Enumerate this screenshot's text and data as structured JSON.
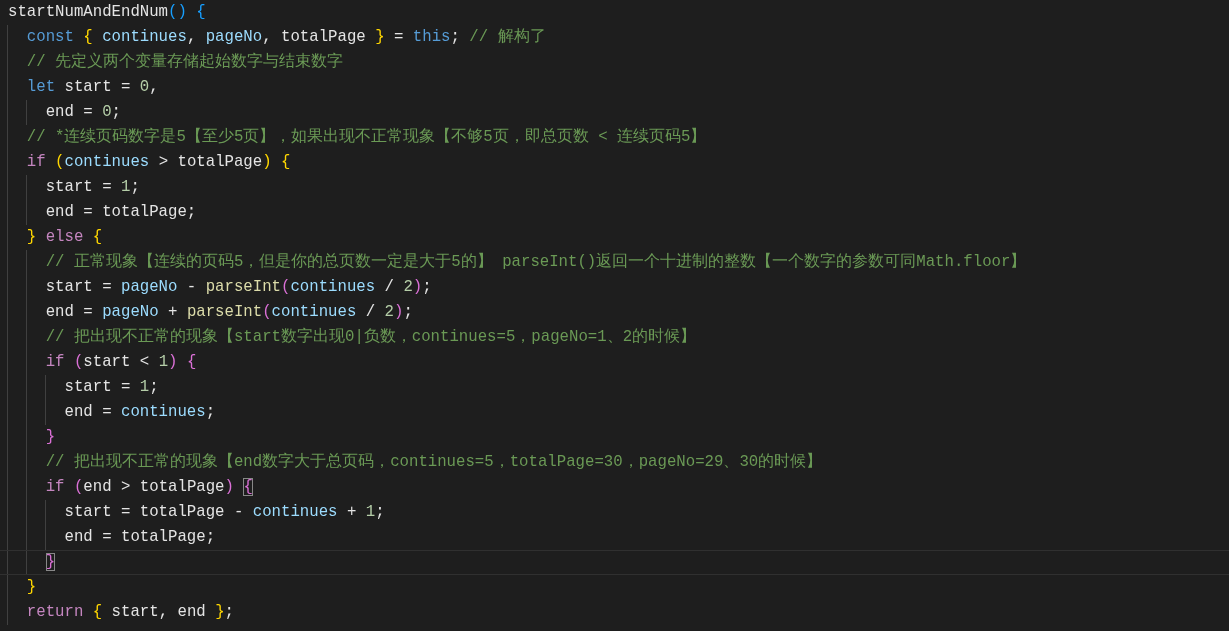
{
  "editor": {
    "lines": [
      {
        "cursor": false,
        "tokens": [
          {
            "kind": "id",
            "text": "startNumAndEndNum"
          },
          {
            "kind": "b3",
            "text": "() "
          },
          {
            "kind": "b3",
            "text": "{"
          }
        ]
      },
      {
        "cursor": false,
        "tokens": [
          {
            "kind": "kw",
            "text": "  const "
          },
          {
            "kind": "b1",
            "text": "{ "
          },
          {
            "kind": "var",
            "text": "continues"
          },
          {
            "kind": "op",
            "text": ", "
          },
          {
            "kind": "var",
            "text": "pageNo"
          },
          {
            "kind": "op",
            "text": ", totalPage "
          },
          {
            "kind": "b1",
            "text": "}"
          },
          {
            "kind": "op",
            "text": " = "
          },
          {
            "kind": "kw",
            "text": "this"
          },
          {
            "kind": "op",
            "text": "; "
          },
          {
            "kind": "cm",
            "text": "// 解构了"
          }
        ]
      },
      {
        "cursor": false,
        "tokens": [
          {
            "kind": "cm",
            "text": "  // 先定义两个变量存储起始数字与结束数字"
          }
        ]
      },
      {
        "cursor": false,
        "tokens": [
          {
            "kind": "kw",
            "text": "  let"
          },
          {
            "kind": "op",
            "text": " start = "
          },
          {
            "kind": "num",
            "text": "0"
          },
          {
            "kind": "op",
            "text": ","
          }
        ]
      },
      {
        "cursor": false,
        "tokens": [
          {
            "kind": "op",
            "text": "    end = "
          },
          {
            "kind": "num",
            "text": "0"
          },
          {
            "kind": "op",
            "text": ";"
          }
        ]
      },
      {
        "cursor": false,
        "tokens": [
          {
            "kind": "cm",
            "text": "  // *连续页码数字是5【至少5页】，如果出现不正常现象【不够5页，即总页数 < 连续页码5】"
          }
        ]
      },
      {
        "cursor": false,
        "tokens": [
          {
            "kind": "ctl",
            "text": "  if "
          },
          {
            "kind": "b1",
            "text": "("
          },
          {
            "kind": "var",
            "text": "continues"
          },
          {
            "kind": "op",
            "text": " > totalPage"
          },
          {
            "kind": "b1",
            "text": ") "
          },
          {
            "kind": "b1",
            "text": "{"
          }
        ]
      },
      {
        "cursor": false,
        "tokens": [
          {
            "kind": "op",
            "text": "    start = "
          },
          {
            "kind": "num",
            "text": "1"
          },
          {
            "kind": "op",
            "text": ";"
          }
        ]
      },
      {
        "cursor": false,
        "tokens": [
          {
            "kind": "op",
            "text": "    end = totalPage;"
          }
        ]
      },
      {
        "cursor": false,
        "tokens": [
          {
            "kind": "b1",
            "text": "  } "
          },
          {
            "kind": "ctl",
            "text": "else "
          },
          {
            "kind": "b1",
            "text": "{"
          }
        ]
      },
      {
        "cursor": false,
        "tokens": [
          {
            "kind": "cm",
            "text": "    // 正常现象【连续的页码5，但是你的总页数一定是大于5的】 parseInt()返回一个十进制的整数【一个数字的参数可同Math.floor】"
          }
        ]
      },
      {
        "cursor": false,
        "tokens": [
          {
            "kind": "op",
            "text": "    start = "
          },
          {
            "kind": "var",
            "text": "pageNo"
          },
          {
            "kind": "op",
            "text": " - "
          },
          {
            "kind": "fn",
            "text": "parseInt"
          },
          {
            "kind": "b2",
            "text": "("
          },
          {
            "kind": "var",
            "text": "continues"
          },
          {
            "kind": "op",
            "text": " / "
          },
          {
            "kind": "num",
            "text": "2"
          },
          {
            "kind": "b2",
            "text": ")"
          },
          {
            "kind": "op",
            "text": ";"
          }
        ]
      },
      {
        "cursor": false,
        "tokens": [
          {
            "kind": "op",
            "text": "    end = "
          },
          {
            "kind": "var",
            "text": "pageNo"
          },
          {
            "kind": "op",
            "text": " + "
          },
          {
            "kind": "fn",
            "text": "parseInt"
          },
          {
            "kind": "b2",
            "text": "("
          },
          {
            "kind": "var",
            "text": "continues"
          },
          {
            "kind": "op",
            "text": " / "
          },
          {
            "kind": "num",
            "text": "2"
          },
          {
            "kind": "b2",
            "text": ")"
          },
          {
            "kind": "op",
            "text": ";"
          }
        ]
      },
      {
        "cursor": false,
        "tokens": [
          {
            "kind": "cm",
            "text": "    // 把出现不正常的现象【start数字出现0|负数，continues=5，pageNo=1、2的时候】"
          }
        ]
      },
      {
        "cursor": false,
        "tokens": [
          {
            "kind": "ctl",
            "text": "    if "
          },
          {
            "kind": "b2",
            "text": "("
          },
          {
            "kind": "op",
            "text": "start < "
          },
          {
            "kind": "num",
            "text": "1"
          },
          {
            "kind": "b2",
            "text": ") "
          },
          {
            "kind": "b2",
            "text": "{"
          }
        ]
      },
      {
        "cursor": false,
        "tokens": [
          {
            "kind": "op",
            "text": "      start = "
          },
          {
            "kind": "num",
            "text": "1"
          },
          {
            "kind": "op",
            "text": ";"
          }
        ]
      },
      {
        "cursor": false,
        "tokens": [
          {
            "kind": "op",
            "text": "      end = "
          },
          {
            "kind": "var",
            "text": "continues"
          },
          {
            "kind": "op",
            "text": ";"
          }
        ]
      },
      {
        "cursor": false,
        "tokens": [
          {
            "kind": "b2",
            "text": "    }"
          }
        ]
      },
      {
        "cursor": false,
        "tokens": [
          {
            "kind": "cm",
            "text": "    // 把出现不正常的现象【end数字大于总页码，continues=5，totalPage=30，pageNo=29、30的时候】"
          }
        ]
      },
      {
        "cursor": false,
        "tokens": [
          {
            "kind": "ctl",
            "text": "    if "
          },
          {
            "kind": "b2",
            "text": "("
          },
          {
            "kind": "op",
            "text": "end > totalPage"
          },
          {
            "kind": "b2",
            "text": ") "
          },
          {
            "kind": "b2",
            "text": "{",
            "matched": true
          }
        ]
      },
      {
        "cursor": false,
        "tokens": [
          {
            "kind": "op",
            "text": "      start = totalPage - "
          },
          {
            "kind": "var",
            "text": "continues"
          },
          {
            "kind": "op",
            "text": " + "
          },
          {
            "kind": "num",
            "text": "1"
          },
          {
            "kind": "op",
            "text": ";"
          }
        ]
      },
      {
        "cursor": false,
        "tokens": [
          {
            "kind": "op",
            "text": "      end = totalPage;"
          }
        ]
      },
      {
        "cursor": true,
        "tokens": [
          {
            "kind": "b2",
            "text": "    }",
            "matched": true
          }
        ]
      },
      {
        "cursor": false,
        "tokens": [
          {
            "kind": "b1",
            "text": "  }"
          }
        ]
      },
      {
        "cursor": false,
        "tokens": [
          {
            "kind": "ctl",
            "text": "  return "
          },
          {
            "kind": "b1",
            "text": "{"
          },
          {
            "kind": "op",
            "text": " start, end "
          },
          {
            "kind": "b1",
            "text": "}"
          },
          {
            "kind": "op",
            "text": ";"
          }
        ]
      }
    ]
  }
}
